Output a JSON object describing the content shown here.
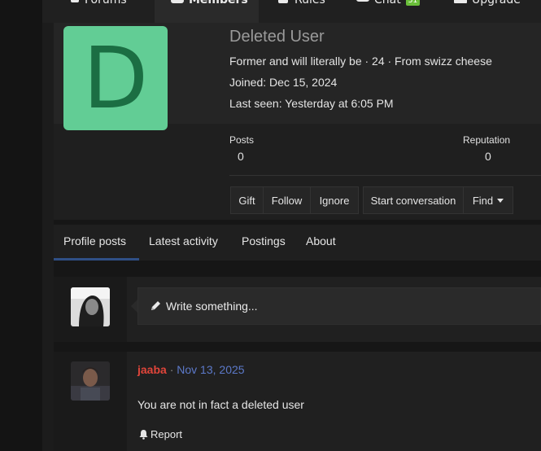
{
  "nav": {
    "items": [
      {
        "label": "Forums",
        "icon": "comments-icon"
      },
      {
        "label": "Members",
        "icon": "users-icon"
      },
      {
        "label": "Rules",
        "icon": "scroll-icon"
      },
      {
        "label": "Chat",
        "icon": "chat-icon",
        "badge": "51"
      },
      {
        "label": "Upgrade",
        "icon": "upgrade-icon"
      }
    ]
  },
  "profile": {
    "avatar_letter": "D",
    "avatar_color": "#62cd95",
    "username": "Deleted User",
    "tagline": "Former and will literally be · 24 · From swizz cheese",
    "joined_label": "Joined:",
    "joined_value": "Dec 15, 2024",
    "last_seen_label": "Last seen:",
    "last_seen_value": "Yesterday at 6:05 PM",
    "stats": {
      "posts_label": "Posts",
      "posts_value": "0",
      "reputation_label": "Reputation",
      "reputation_value": "0"
    },
    "buttons": {
      "gift": "Gift",
      "follow": "Follow",
      "ignore": "Ignore",
      "start_conversation": "Start conversation",
      "find": "Find"
    }
  },
  "tabs": {
    "items": [
      "Profile posts",
      "Latest activity",
      "Postings",
      "About"
    ],
    "active": "Profile posts"
  },
  "composer": {
    "placeholder": "Write something..."
  },
  "post": {
    "author": "jaaba",
    "separator": "·",
    "date": "Nov 13, 2025",
    "body": "You are not in fact a deleted user",
    "report_label": "Report"
  },
  "colors": {
    "accent": "#2f4f86",
    "author_red": "#e0453a",
    "date_blue": "#5c79c9",
    "badge_green": "#6abf3a"
  }
}
